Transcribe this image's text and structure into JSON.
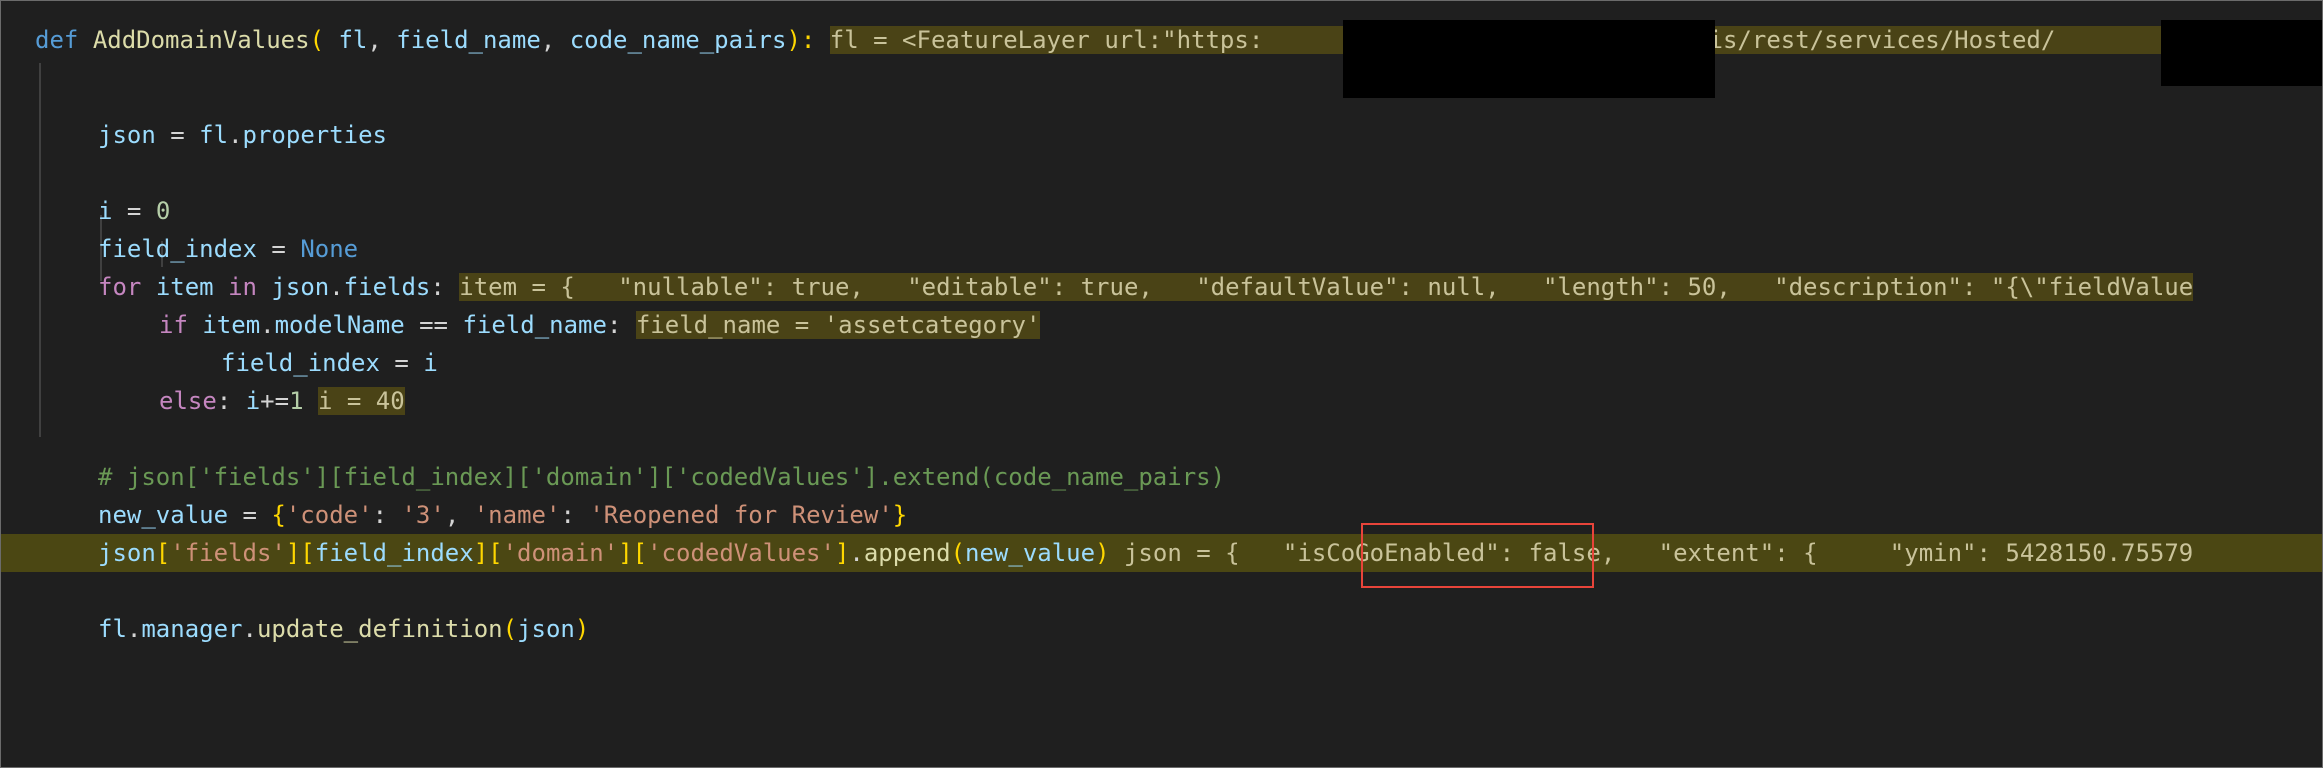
{
  "code": {
    "line1": {
      "def_kw": "def",
      "func_name": "AddDomainValues",
      "open_paren": "(",
      "param1": "fl",
      "comma1": ", ",
      "param2": "field_name",
      "comma2": ", ",
      "param3": "code_name_pairs",
      "close": "):",
      "inline_hint_a": "fl = <FeatureLayer url:\"https:",
      "inline_hint_b": "/arcgis/rest/services/Hosted/"
    },
    "line2": {
      "var": "json",
      "op": " = ",
      "obj": "fl",
      "dot": ".",
      "attr": "properties"
    },
    "line3": {
      "var": "i",
      "op": " = ",
      "num": "0"
    },
    "line4": {
      "var": "field_index",
      "op": " = ",
      "const": "None"
    },
    "line5": {
      "kw_for": "for",
      "var": "item",
      "kw_in": "in",
      "obj": "json",
      "attr": "fields",
      "colon": ":",
      "inline_hint": "item = {   \"nullable\": true,   \"editable\": true,   \"defaultValue\": null,   \"length\": 50,   \"description\": \"{\\\"fieldValue"
    },
    "line6": {
      "kw_if": "if",
      "obj": "item",
      "attr": "modelName",
      "op": " == ",
      "var": "field_name",
      "colon": ":",
      "inline_hint": "field_name = 'assetcategory'"
    },
    "line7": {
      "var": "field_index",
      "op": " = ",
      "rhs": "i"
    },
    "line8": {
      "kw_else": "else",
      "colon": ":",
      "stmt_var": "i",
      "stmt_op": "+=",
      "stmt_num": "1",
      "inline_hint": "i = 40"
    },
    "line9": {
      "comment": "# json['fields'][field_index]['domain']['codedValues'].extend(code_name_pairs)"
    },
    "line10": {
      "var": "new_value",
      "op": " = ",
      "brace_open": "{",
      "k1": "'code'",
      "sep1": ": ",
      "v1": "'3'",
      "comma": ", ",
      "k2": "'name'",
      "sep2": ": ",
      "v2": "'Reopened for Review'",
      "brace_close": "}"
    },
    "line11": {
      "obj": "json",
      "b1o": "[",
      "s1": "'fields'",
      "b1c": "]",
      "b2o": "[",
      "s2": "field_index",
      "b2c": "]",
      "b3o": "[",
      "s3": "'domain'",
      "b3c": "]",
      "b4o": "[",
      "s4": "'codedValues'",
      "b4c": "]",
      "dot": ".",
      "method": "append",
      "po": "(",
      "arg": "new_value",
      "pc": ")",
      "inline_hint_a": "json = {   ",
      "inline_hint_key": "\"isCoGoEnabled\"",
      "inline_hint_b": ": false,   \"extent\": {     \"ymin\": 5428150.75579"
    },
    "line12": {
      "obj": "fl",
      "dot1": ".",
      "attr": "manager",
      "dot2": ".",
      "method": "update_definition",
      "po": "(",
      "arg": "json",
      "pc": ")"
    }
  },
  "annotation_color": "#e8443a",
  "highlight_line_color": "#4b4713"
}
